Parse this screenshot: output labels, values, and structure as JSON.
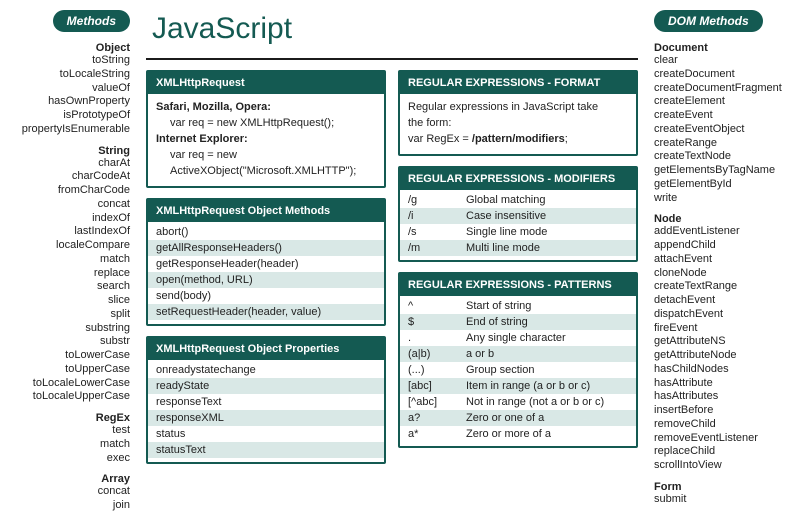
{
  "title": "JavaScript",
  "left": {
    "pill": "Methods",
    "groups": [
      {
        "hdr": "Object",
        "items": [
          "toString",
          "toLocaleString",
          "valueOf",
          "hasOwnProperty",
          "isPrototypeOf",
          "propertyIsEnumerable"
        ]
      },
      {
        "hdr": "String",
        "items": [
          "charAt",
          "charCodeAt",
          "fromCharCode",
          "concat",
          "indexOf",
          "lastIndexOf",
          "localeCompare",
          "match",
          "replace",
          "search",
          "slice",
          "split",
          "substring",
          "substr",
          "toLowerCase",
          "toUpperCase",
          "toLocaleLowerCase",
          "toLocaleUpperCase"
        ]
      },
      {
        "hdr": "RegEx",
        "items": [
          "test",
          "match",
          "exec"
        ]
      },
      {
        "hdr": "Array",
        "items": [
          "concat",
          "join"
        ]
      }
    ]
  },
  "right": {
    "pill": "DOM Methods",
    "groups": [
      {
        "hdr": "Document",
        "items": [
          "clear",
          "createDocument",
          "createDocumentFragment",
          "createElement",
          "createEvent",
          "createEventObject",
          "createRange",
          "createTextNode",
          "getElementsByTagName",
          "getElementById",
          "write"
        ]
      },
      {
        "hdr": "Node",
        "items": [
          "addEventListener",
          "appendChild",
          "attachEvent",
          "cloneNode",
          "createTextRange",
          "detachEvent",
          "dispatchEvent",
          "fireEvent",
          "getAttributeNS",
          "getAttributeNode",
          "hasChildNodes",
          "hasAttribute",
          "hasAttributes",
          "insertBefore",
          "removeChild",
          "removeEventListener",
          "replaceChild",
          "scrollIntoView"
        ]
      },
      {
        "hdr": "Form",
        "items": [
          "submit"
        ]
      }
    ]
  },
  "xhr": {
    "hdr": "XMLHttpRequest",
    "b1": "Safari, Mozilla, Opera:",
    "c1": "var req = new XMLHttpRequest();",
    "b2": "Internet Explorer:",
    "c2a": "var req = new",
    "c2b": "ActiveXObject(\"Microsoft.XMLHTTP\");"
  },
  "xhrMethods": {
    "hdr": "XMLHttpRequest Object Methods",
    "rows": [
      "abort()",
      "getAllResponseHeaders()",
      "getResponseHeader(header)",
      "open(method, URL)",
      "send(body)",
      "setRequestHeader(header, value)"
    ]
  },
  "xhrProps": {
    "hdr": "XMLHttpRequest Object Properties",
    "rows": [
      "onreadystatechange",
      "readyState",
      "responseText",
      "responseXML",
      "status",
      "statusText"
    ]
  },
  "reFormat": {
    "hdr": "REGULAR EXPRESSIONS - FORMAT",
    "l1": "Regular expressions in JavaScript take",
    "l2": "the form:",
    "l3a": "var RegEx = ",
    "l3b": "/pattern/modifiers",
    "l3c": ";"
  },
  "reMods": {
    "hdr": "REGULAR EXPRESSIONS - MODIFIERS",
    "rows": [
      {
        "k": "/g",
        "v": "Global matching"
      },
      {
        "k": "/i",
        "v": "Case insensitive"
      },
      {
        "k": "/s",
        "v": "Single line mode"
      },
      {
        "k": "/m",
        "v": "Multi line mode"
      }
    ]
  },
  "rePatt": {
    "hdr": "REGULAR EXPRESSIONS - PATTERNS",
    "rows": [
      {
        "k": "^",
        "v": "Start of string"
      },
      {
        "k": "$",
        "v": "End of string"
      },
      {
        "k": ".",
        "v": "Any single character"
      },
      {
        "k": "(a|b)",
        "v": "a or b"
      },
      {
        "k": "(...)",
        "v": "Group section"
      },
      {
        "k": "[abc]",
        "v": "Item in range (a or b or c)"
      },
      {
        "k": "[^abc]",
        "v": "Not in range (not a or b or c)"
      },
      {
        "k": "a?",
        "v": "Zero or one of a"
      },
      {
        "k": "a*",
        "v": "Zero or more of a"
      }
    ]
  }
}
